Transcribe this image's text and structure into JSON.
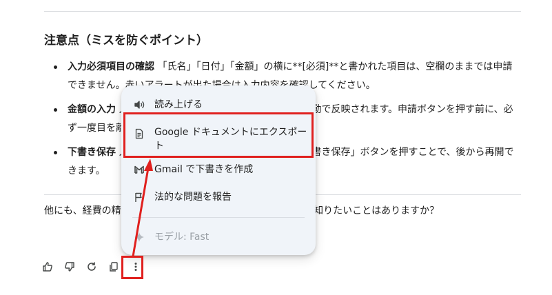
{
  "section": {
    "heading": "注意点（ミスを防ぐポイント）",
    "bullets": [
      {
        "title": "入力必須項目の確認",
        "text": "「氏名」「日付」「金額」の横に**[必須]**と書かれた項目は、空欄のままでは申請できません。赤いアラートが出た場合は入力内容を確認してください。"
      },
      {
        "title": "金額の入力",
        "text": "入力した金額は、下部の「合計金額」欄に自動で反映されます。申請ボタンを押す前に、必ず一度目を離して再確認しましょう。"
      },
      {
        "title": "下書き保存",
        "text": "入力の途中で中断する場合は、一番下の「下書き保存」ボタンを押すことで、後から再開できます。"
      }
    ],
    "followup": "他にも、経費の精算方法や申請した後の確認方法などについて知りたいことはありますか？"
  },
  "menu": {
    "items": [
      {
        "label": "読み上げる",
        "icon": "speaker-icon"
      },
      {
        "label": "Google ドキュメントにエクスポート",
        "icon": "document-icon"
      },
      {
        "label": "Gmail で下書きを作成",
        "icon": "gmail-icon"
      },
      {
        "label": "法的な問題を報告",
        "icon": "flag-icon"
      }
    ],
    "model_label": "モデル: Fast",
    "model_icon": "sparkle-icon"
  },
  "actions": [
    "thumbs-up-icon",
    "thumbs-down-icon",
    "regenerate-icon",
    "copy-icon",
    "more-vertical-icon"
  ],
  "annotation_color": "#e0201e"
}
